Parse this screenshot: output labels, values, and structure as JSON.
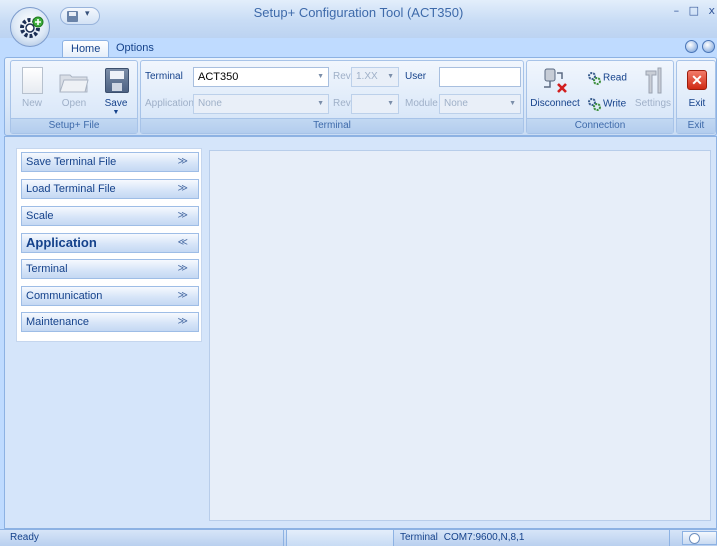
{
  "window": {
    "title": "Setup+ Configuration Tool (ACT350)",
    "controls": [
      "–",
      "□",
      "x"
    ]
  },
  "tabs": [
    {
      "label": "Home",
      "active": true
    },
    {
      "label": "Options",
      "active": false
    }
  ],
  "ribbon": {
    "file_group": {
      "caption": "Setup+ File",
      "new_label": "New",
      "open_label": "Open",
      "save_label": "Save"
    },
    "terminal_group": {
      "caption": "Terminal",
      "terminal_label": "Terminal",
      "terminal_value": "ACT350",
      "rev_label": "Rev.",
      "rev_value": "1.XX",
      "user_label": "User",
      "user_value": "",
      "application_label": "Application",
      "application_value": "None",
      "rev2_label": "Rev.",
      "rev2_value": "",
      "module_label": "Module",
      "module_value": "None"
    },
    "connection_group": {
      "caption": "Connection",
      "disconnect_label": "Disconnect",
      "read_label": "Read",
      "write_label": "Write",
      "settings_label": "Settings"
    },
    "exit_group": {
      "caption": "Exit",
      "exit_label": "Exit"
    }
  },
  "nav": {
    "items": [
      {
        "label": "Save Terminal File",
        "chevron": "≫"
      },
      {
        "label": "Load Terminal File",
        "chevron": "≫"
      },
      {
        "label": "Scale",
        "chevron": "≫"
      },
      {
        "label": "Application",
        "chevron": "≪",
        "active": true
      },
      {
        "label": "Terminal",
        "chevron": "≫"
      },
      {
        "label": "Communication",
        "chevron": "≫"
      },
      {
        "label": "Maintenance",
        "chevron": "≫"
      }
    ]
  },
  "status": {
    "ready": "Ready",
    "terminal_label": "Terminal",
    "terminal_value": "COM7:9600,N,8,1"
  },
  "colors": {
    "accent": "#15428b",
    "ribbon_bg": "#dbe8f8",
    "exit_red": "#cf2a14"
  }
}
